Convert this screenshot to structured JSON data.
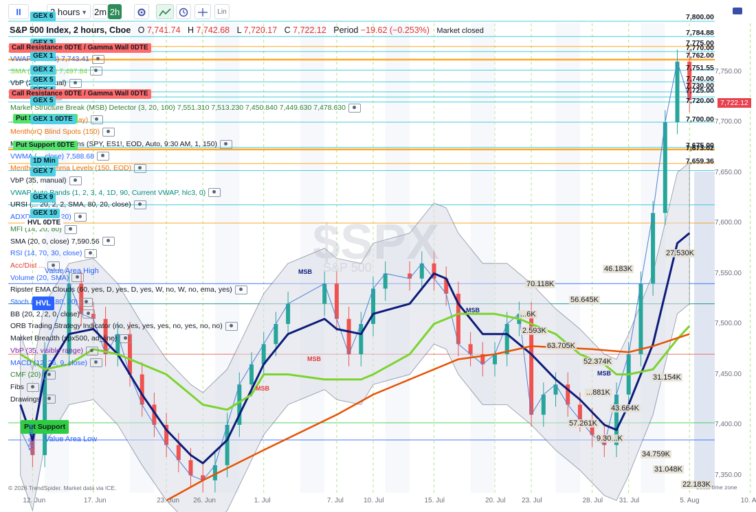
{
  "toolbar": {
    "pause_label": "II",
    "interval": "2 hours",
    "btn_2m": "2m",
    "btn_2h": "2h",
    "lin_label": "Lin"
  },
  "header": {
    "title": "S&P 500 Index, 2 hours, Cboe",
    "o_label": "O",
    "o": "7,741.74",
    "h_label": "H",
    "h": "7,742.68",
    "l_label": "L",
    "l": "7,720.17",
    "c_label": "C",
    "c": "7,722.12",
    "period_label": "Period",
    "period": "−19.62 (−0.253%)",
    "status": "Market closed"
  },
  "indicators": [
    {
      "text": "VWAP (... hlc3)   7,743.41",
      "color": "#2962ff"
    },
    {
      "text": "SMA (... close)   7,497.84",
      "color": "#7cd32f"
    },
    {
      "text": "VbP (25, manual)",
      "color": "#131722"
    },
    {
      "text": "... 7,329.06",
      "color": "#131722"
    },
    {
      "text": "Market Structure Break (MSB) Detector (3, 20, 100)   7,551.310  7,513.230  7,450.840  7,449.630  7,478.630",
      "color": "#2e7d32"
    },
    {
      "text": "... Levels (150, Intraday)",
      "color": "#ef6c00"
    },
    {
      "text": "MenthorQ Blind Spots (150)",
      "color": "#ef6c00"
    },
    {
      "text": "MenthorQ Conversions (SPY, ES1!, EOD, Auto, 9:30 AM, 1, 150)",
      "color": "#131722"
    },
    {
      "text": "VWMA (... close)   7,588.68",
      "color": "#2962ff"
    },
    {
      "text": "MenthorQ Gamma Levels (150, EOD)",
      "color": "#ef6c00"
    },
    {
      "text": "VbP (35, manual)",
      "color": "#131722"
    },
    {
      "text": "VWAP Auto Bands (1, 2, 3, 4, 1D, 90, Current VWAP, hlc3, 0)",
      "color": "#00897b"
    },
    {
      "text": "URSI (... 20, 2, 2, SMA, 80, 20, close)",
      "color": "#131722"
    },
    {
      "text": "ADXDI (14, 35, 20)",
      "color": "#2962ff"
    },
    {
      "text": "MFI (14, 20, 80)",
      "color": "#2e7d32"
    },
    {
      "text": "SMA (20, 0, close)   7,590.56",
      "color": "#131722"
    },
    {
      "text": "RSI (14, 70, 30, close)",
      "color": "#2962ff"
    },
    {
      "text": "Acc/Dist ...",
      "color": "#e53935"
    },
    {
      "text": "Volume (20, SMA)",
      "color": "#2962ff"
    },
    {
      "text": "Ripster EMA Clouds (60, yes, D, yes, D, yes, W, no, W, no, ema, yes)",
      "color": "#131722"
    },
    {
      "text": "Stoch (14, ..., 80, 20)",
      "color": "#2962ff"
    },
    {
      "text": "BB (20, 2, 2, 0, close)",
      "color": "#131722"
    },
    {
      "text": "ORB Trading Strategy Indicator (no, yes, yes, yes, no, yes, no, no)",
      "color": "#131722"
    },
    {
      "text": "Market Breadth (spx500, ad_line)",
      "color": "#131722"
    },
    {
      "text": "VbP (35, visible range)",
      "color": "#7b1fa2"
    },
    {
      "text": "MACD (12, 26, 9, close)",
      "color": "#2962ff"
    },
    {
      "text": "CMF (20)",
      "color": "#2e7d32"
    },
    {
      "text": "Fibs",
      "color": "#131722"
    },
    {
      "text": "Drawings",
      "color": "#131722"
    }
  ],
  "level_tags": [
    {
      "text": "GEX 6",
      "bg": "#4dd0e1"
    },
    {
      "text": "GEX 3",
      "bg": "#4dd0e1"
    },
    {
      "text": "Call Resistance 0DTE / Gamma Wall 0DTE",
      "bg": "#ff6b6b"
    },
    {
      "text": "GEX 1",
      "bg": "#4dd0e1"
    },
    {
      "text": "GEX 2",
      "bg": "#4dd0e1"
    },
    {
      "text": "GEX 5",
      "bg": "#4dd0e1"
    },
    {
      "text": "GEX 4",
      "bg": "#4dd0e1"
    },
    {
      "text": "Call Resistance 0DTE / Gamma Wall 0DTE",
      "bg": "#ff6b6b"
    },
    {
      "text": "GEX 5",
      "bg": "#4dd0e1"
    },
    {
      "text": "Put Support 0DTE",
      "bg": "#54e36a"
    },
    {
      "text": "GEX 1 0DTE",
      "bg": "#4dd0e1"
    },
    {
      "text": "Put Support 0DTE",
      "bg": "#54e36a"
    },
    {
      "text": "1D Min",
      "bg": "#4dd0e1"
    },
    {
      "text": "GEX 7",
      "bg": "#4dd0e1"
    },
    {
      "text": "GEX 9",
      "bg": "#4dd0e1"
    },
    {
      "text": "GEX 10",
      "bg": "#4dd0e1"
    },
    {
      "text": "HVL 0DTE",
      "bg": "#ffffff"
    },
    {
      "text": "HVL",
      "bg": "#2962ff"
    },
    {
      "text": "Put Support",
      "bg": "#2ecc40"
    }
  ],
  "price_labels": [
    "7,800.00",
    "7,784.88",
    "7,775.00",
    "7,770.00",
    "7,762.00",
    "7,751.55",
    "7,740.00",
    "7,730.00",
    "7,725.00",
    "7,720.00",
    "7,700.00",
    "7,675.00",
    "7,673.02",
    "7,659.36"
  ],
  "last_price": "7,722.12",
  "y_axis": [
    "7,750.00",
    "7,700.00",
    "7,650.00",
    "7,600.00",
    "7,550.00",
    "7,500.00",
    "7,450.00",
    "7,400.00",
    "7,350.00"
  ],
  "x_axis": [
    "12. Jun",
    "17. Jun",
    "23. Jun",
    "26. Jun",
    "1. Jul",
    "7. Jul",
    "10. Jul",
    "15. Jul",
    "20. Jul",
    "23. Jul",
    "28. Jul",
    "31. Jul",
    "5. Aug",
    "10. Aug"
  ],
  "profile_labels": [
    "46.183K",
    "27.530K",
    "70.118K",
    "56.645K",
    "...6K",
    "2.593K",
    "63.705K",
    "52.374K",
    "31.154K",
    "...881K",
    "43.664K",
    "57.261K",
    "9.30...K",
    "34.759K",
    "31.048K",
    "22.183K"
  ],
  "annotations": {
    "value_area_high": "Value Area High",
    "value_area_low": "Value Area Low",
    "msb": "MSB",
    "vbp_start": "VbP start",
    "watermark": "$SPX",
    "watermark_sub": "S&P 500",
    "footer": "© 2026 TrendSpider. Market data via ICE.",
    "footer_right": "Local time zone"
  },
  "colors": {
    "up": "#26a69a",
    "down": "#ef5350",
    "sma_green": "#7cd32f",
    "ema_orange": "#e65100",
    "navy": "#0d1b7a",
    "bb": "#4f5e7a",
    "bb_fill": "#d9dee6",
    "level_cyan": "#4dd0e1",
    "level_orange": "#ff9800"
  },
  "chart_data": {
    "type": "line",
    "title": "S&P 500 Index, 2 hours, Cboe",
    "x_ticks": [
      "12. Jun",
      "17. Jun",
      "23. Jun",
      "26. Jun",
      "1. Jul",
      "7. Jul",
      "10. Jul",
      "15. Jul",
      "20. Jul",
      "23. Jul",
      "28. Jul",
      "31. Jul",
      "5. Aug",
      "10. Aug"
    ],
    "y_ticks": [
      7350,
      7400,
      7450,
      7500,
      7550,
      7600,
      7650,
      7700,
      7750
    ],
    "ylim": [
      7330,
      7800
    ],
    "series": [
      {
        "name": "Close",
        "points": [
          [
            "11. Jun",
            7395
          ],
          [
            "12. Jun",
            7370
          ],
          [
            "13. Jun",
            7470
          ],
          [
            "15. Jun",
            7540
          ],
          [
            "16. Jun",
            7510
          ],
          [
            "17. Jun",
            7505
          ],
          [
            "18. Jun",
            7470
          ],
          [
            "19. Jun",
            7490
          ],
          [
            "20. Jun",
            7450
          ],
          [
            "21. Jun",
            7420
          ],
          [
            "22. Jun",
            7400
          ],
          [
            "23. Jun",
            7380
          ],
          [
            "24. Jun",
            7365
          ],
          [
            "25. Jun",
            7350
          ],
          [
            "26. Jun",
            7345
          ],
          [
            "27. Jun",
            7360
          ],
          [
            "28. Jun",
            7400
          ],
          [
            "29. Jun",
            7440
          ],
          [
            "30. Jun",
            7460
          ],
          [
            "1. Jul",
            7480
          ],
          [
            "2. Jul",
            7500
          ],
          [
            "3. Jul",
            7520
          ],
          [
            "6. Jul",
            7540
          ],
          [
            "7. Jul",
            7505
          ],
          [
            "8. Jul",
            7470
          ],
          [
            "9. Jul",
            7500
          ],
          [
            "10. Jul",
            7535
          ],
          [
            "11. Jul",
            7550
          ],
          [
            "13. Jul",
            7545
          ],
          [
            "14. Jul",
            7560
          ],
          [
            "15. Jul",
            7545
          ],
          [
            "16. Jul",
            7530
          ],
          [
            "17. Jul",
            7480
          ],
          [
            "18. Jul",
            7470
          ],
          [
            "19. Jul",
            7460
          ],
          [
            "20. Jul",
            7470
          ],
          [
            "21. Jul",
            7500
          ],
          [
            "22. Jul",
            7510
          ],
          [
            "23. Jul",
            7410
          ],
          [
            "24. Jul",
            7430
          ],
          [
            "25. Jul",
            7440
          ],
          [
            "26. Jul",
            7420
          ],
          [
            "27. Jul",
            7405
          ],
          [
            "28. Jul",
            7390
          ],
          [
            "29. Jul",
            7380
          ],
          [
            "30. Jul",
            7430
          ],
          [
            "31. Jul",
            7470
          ],
          [
            "1. Aug",
            7540
          ],
          [
            "2. Aug",
            7610
          ],
          [
            "3. Aug",
            7700
          ],
          [
            "4. Aug",
            7760
          ],
          [
            "5. Aug",
            7722
          ]
        ]
      },
      {
        "name": "",
        "points": [
          [
            "11. Jun",
            7420
          ],
          [
            "12. Jun",
            7385
          ],
          [
            "13. Jun",
            7450
          ],
          [
            "15. Jun",
            7490
          ],
          [
            "17. Jun",
            7495
          ],
          [
            "19. Jun",
            7470
          ],
          [
            "21. Jun",
            7430
          ],
          [
            "23. Jun",
            7395
          ],
          [
            "25. Jun",
            7370
          ],
          [
            "26. Jun",
            7362
          ],
          [
            "28. Jun",
            7385
          ],
          [
            "30. Jun",
            7435
          ],
          [
            "1. Jul",
            7460
          ],
          [
            "3. Jul",
            7490
          ],
          [
            "6. Jul",
            7505
          ],
          [
            "7. Jul",
            7495
          ],
          [
            "9. Jul",
            7490
          ],
          [
            "10. Jul",
            7510
          ],
          [
            "13. Jul",
            7520
          ],
          [
            "15. Jul",
            7550
          ],
          [
            "16. Jul",
            7545
          ],
          [
            "17. Jul",
            7520
          ],
          [
            "19. Jul",
            7490
          ],
          [
            "21. Jul",
            7490
          ],
          [
            "23. Jul",
            7470
          ],
          [
            "25. Jul",
            7445
          ],
          [
            "27. Jul",
            7425
          ],
          [
            "29. Jul",
            7400
          ],
          [
            "30. Jul",
            7395
          ],
          [
            "31. Jul",
            7420
          ],
          [
            "2. Aug",
            7480
          ],
          [
            "3. Aug",
            7530
          ],
          [
            "4. Aug",
            7580
          ],
          [
            "5. Aug",
            7590
          ]
        ]
      },
      {
        "name": "",
        "points": [
          [
            "11. Jun",
            7470
          ],
          [
            "13. Jun",
            7455
          ],
          [
            "15. Jun",
            7460
          ],
          [
            "17. Jun",
            7475
          ],
          [
            "19. Jun",
            7470
          ],
          [
            "21. Jun",
            7460
          ],
          [
            "23. Jun",
            7450
          ],
          [
            "25. Jun",
            7430
          ],
          [
            "26. Jun",
            7420
          ],
          [
            "28. Jun",
            7415
          ],
          [
            "30. Jun",
            7430
          ],
          [
            "1. Jul",
            7450
          ],
          [
            "3. Jul",
            7450
          ],
          [
            "6. Jul",
            7445
          ],
          [
            "7. Jul",
            7445
          ],
          [
            "9. Jul",
            7445
          ],
          [
            "10. Jul",
            7450
          ],
          [
            "13. Jul",
            7470
          ],
          [
            "15. Jul",
            7500
          ],
          [
            "16. Jul",
            7505
          ],
          [
            "17. Jul",
            7510
          ],
          [
            "20. Jul",
            7510
          ],
          [
            "22. Jul",
            7505
          ],
          [
            "23. Jul",
            7500
          ],
          [
            "25. Jul",
            7490
          ],
          [
            "27. Jul",
            7470
          ],
          [
            "29. Jul",
            7460
          ],
          [
            "30. Jul",
            7450
          ],
          [
            "31. Jul",
            7450
          ],
          [
            "2. Aug",
            7455
          ],
          [
            "3. Aug",
            7470
          ],
          [
            "4. Aug",
            7485
          ],
          [
            "5. Aug",
            7498
          ]
        ]
      },
      {
        "name": "",
        "points": [
          [
            "23. Jun",
            7325
          ],
          [
            "26. Jun",
            7345
          ],
          [
            "1. Jul",
            7375
          ],
          [
            "7. Jul",
            7410
          ],
          [
            "10. Jul",
            7430
          ],
          [
            "15. Jul",
            7455
          ],
          [
            "17. Jul",
            7465
          ],
          [
            "20. Jul",
            7470
          ],
          [
            "23. Jul",
            7478
          ],
          [
            "28. Jul",
            7475
          ],
          [
            "31. Jul",
            7472
          ],
          [
            "2. Aug",
            7478
          ],
          [
            "5. Aug",
            7490
          ]
        ]
      }
    ]
  }
}
